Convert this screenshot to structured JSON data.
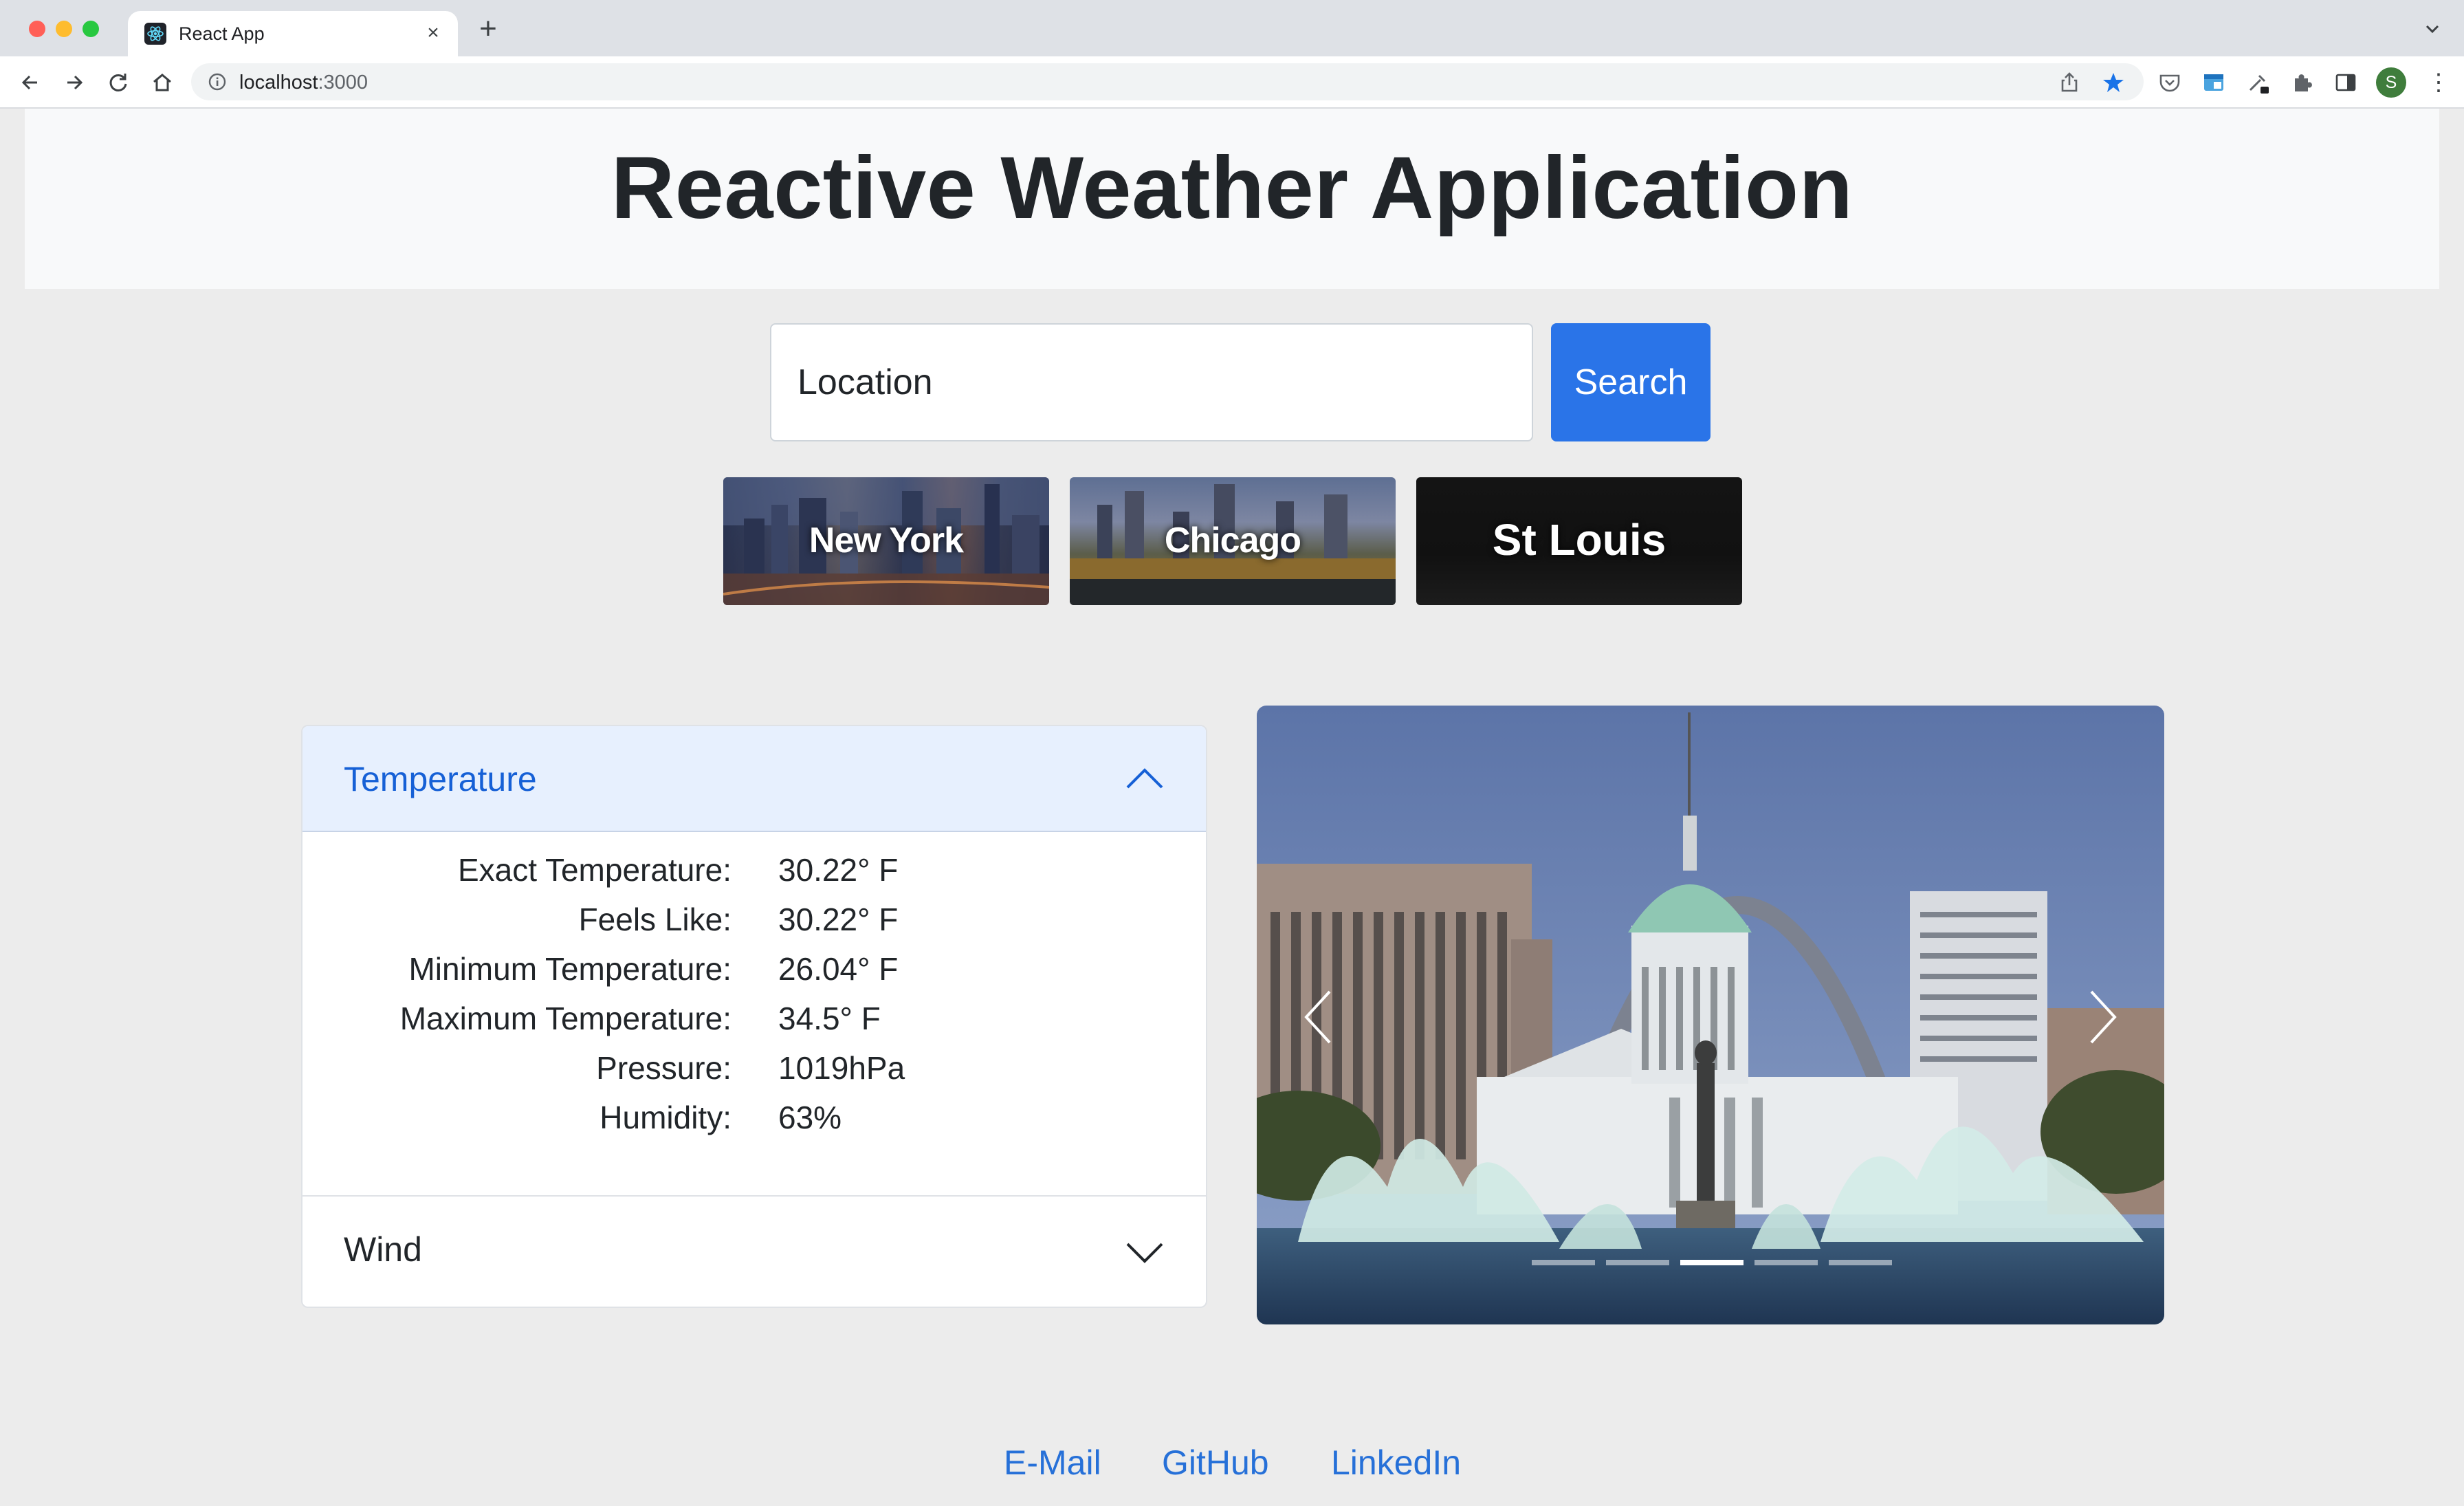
{
  "browser": {
    "tab_title": "React App",
    "tab_close": "×",
    "new_tab": "+",
    "url_host": "localhost",
    "url_rest": ":3000",
    "profile_initial": "S",
    "menu": "⋮"
  },
  "header": {
    "title": "Reactive Weather Application"
  },
  "search": {
    "placeholder": "Location",
    "button_label": "Search"
  },
  "cities": [
    {
      "label": "New York"
    },
    {
      "label": "Chicago"
    },
    {
      "label": "St Louis"
    }
  ],
  "accordion": {
    "temperature": {
      "title": "Temperature",
      "expanded": true,
      "rows": [
        {
          "label": "Exact Temperature:",
          "value": "30.22° F"
        },
        {
          "label": "Feels Like:",
          "value": "30.22° F"
        },
        {
          "label": "Minimum Temperature:",
          "value": "26.04° F"
        },
        {
          "label": "Maximum Temperature:",
          "value": "34.5° F"
        },
        {
          "label": "Pressure:",
          "value": "1019hPa"
        },
        {
          "label": "Humidity:",
          "value": "63%"
        }
      ]
    },
    "wind": {
      "title": "Wind",
      "expanded": false
    }
  },
  "carousel": {
    "slide_count": 5,
    "active_index": 2
  },
  "footer": {
    "links": [
      {
        "label": "E-Mail"
      },
      {
        "label": "GitHub"
      },
      {
        "label": "LinkedIn"
      }
    ]
  },
  "colors": {
    "primary": "#2a74e8",
    "link": "#2670d8",
    "accordion_active_bg": "#e7f0fe",
    "page_bg": "#ececec"
  }
}
